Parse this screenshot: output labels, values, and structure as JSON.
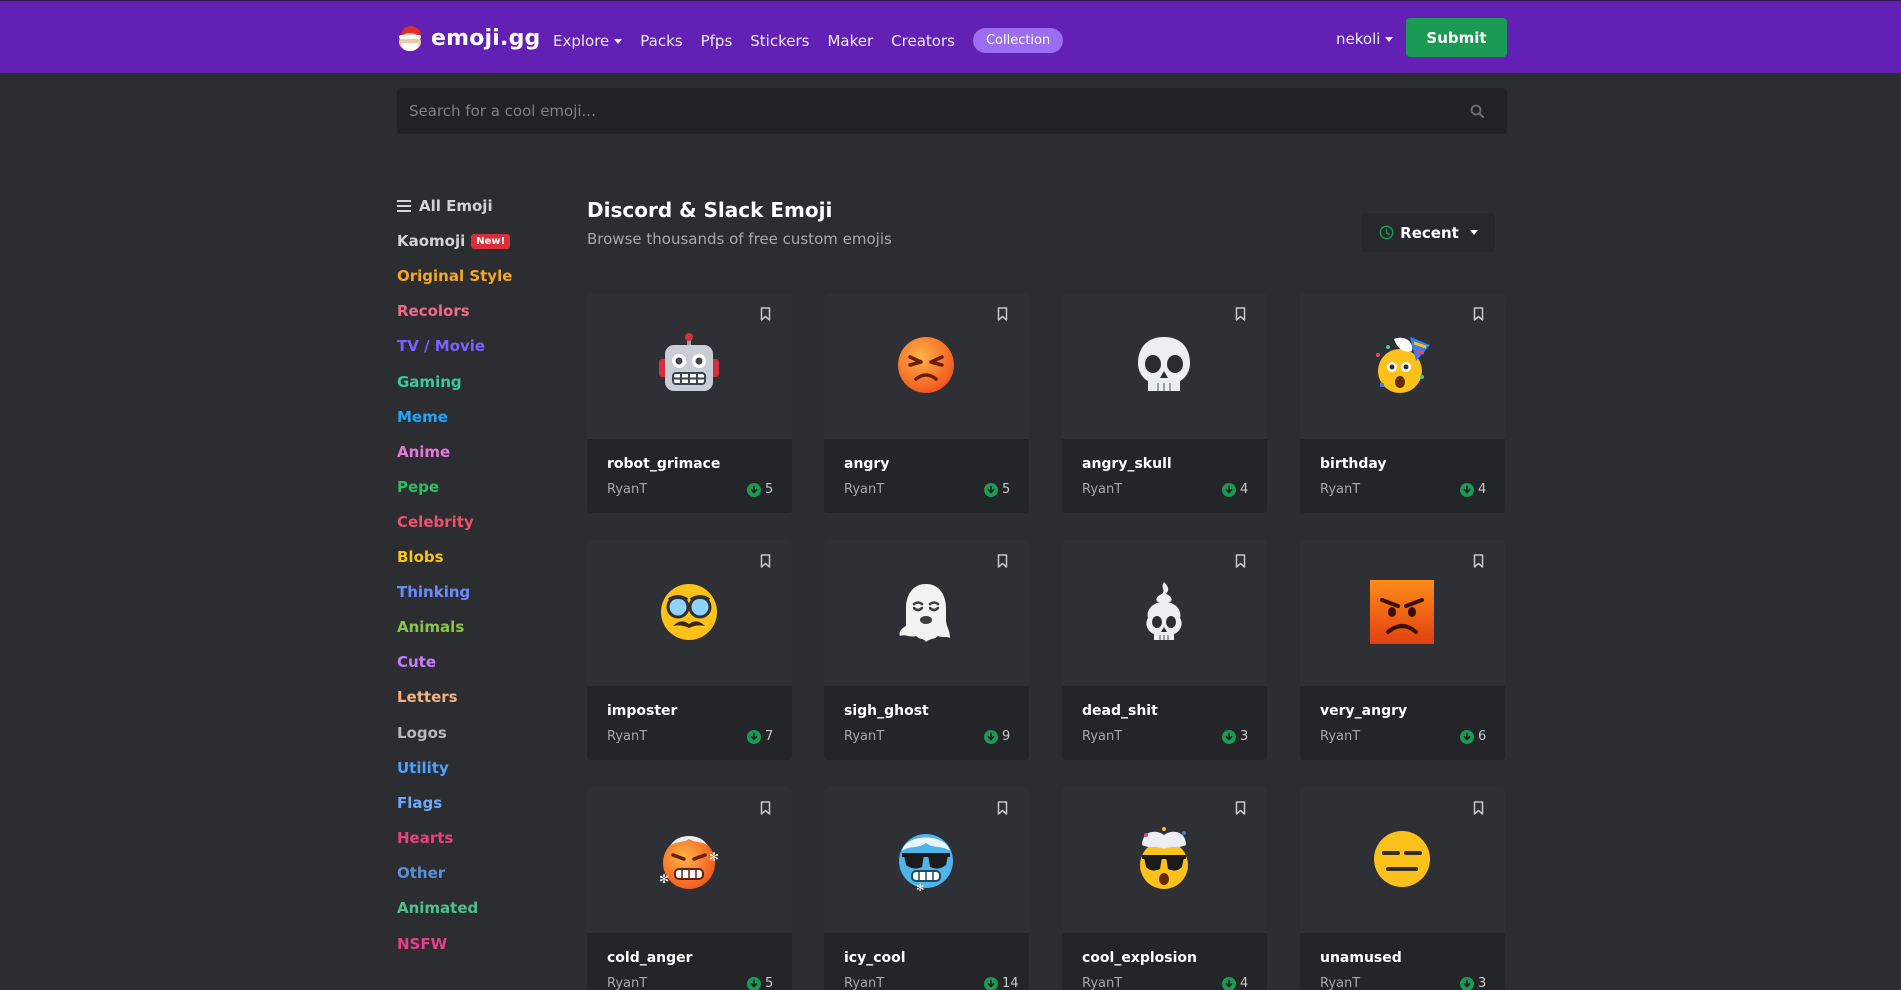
{
  "navbar": {
    "brand": "emoji.gg",
    "links": [
      {
        "label": "Explore",
        "dropdown": true
      },
      {
        "label": "Packs"
      },
      {
        "label": "Pfps"
      },
      {
        "label": "Stickers"
      },
      {
        "label": "Maker"
      },
      {
        "label": "Creators"
      }
    ],
    "collection_label": "Collection",
    "user": "nekoli",
    "submit_label": "Submit"
  },
  "search": {
    "placeholder": "Search for a cool emoji..."
  },
  "sidebar": {
    "all_label": "All Emoji",
    "new_badge": "New!",
    "items": [
      {
        "label": "Kaomoji",
        "color": "#d4d4d8",
        "badge": true
      },
      {
        "label": "Original Style",
        "color": "#f5a623"
      },
      {
        "label": "Recolors",
        "color": "#f06b8b"
      },
      {
        "label": "TV / Movie",
        "color": "#7b61ff"
      },
      {
        "label": "Gaming",
        "color": "#3ec8a0"
      },
      {
        "label": "Meme",
        "color": "#1ea7fd"
      },
      {
        "label": "Anime",
        "color": "#e37ad8"
      },
      {
        "label": "Pepe",
        "color": "#2dbe60"
      },
      {
        "label": "Celebrity",
        "color": "#f0506e"
      },
      {
        "label": "Blobs",
        "color": "#f5c518"
      },
      {
        "label": "Thinking",
        "color": "#6b8cff"
      },
      {
        "label": "Animals",
        "color": "#8bc34a"
      },
      {
        "label": "Cute",
        "color": "#c77dff"
      },
      {
        "label": "Letters",
        "color": "#f4b183"
      },
      {
        "label": "Logos",
        "color": "#b8b8bd"
      },
      {
        "label": "Utility",
        "color": "#4fa3ff"
      },
      {
        "label": "Flags",
        "color": "#6ea8ff"
      },
      {
        "label": "Hearts",
        "color": "#e8427c"
      },
      {
        "label": "Other",
        "color": "#5c8fd6"
      },
      {
        "label": "Animated",
        "color": "#4fc08d"
      },
      {
        "label": "NSFW",
        "color": "#e83e8c"
      }
    ]
  },
  "main": {
    "title": "Discord & Slack Emoji",
    "subtitle": "Browse thousands of free custom emojis",
    "sort_label": "Recent"
  },
  "emojis": [
    {
      "name": "robot_grimace",
      "author": "RyanT",
      "downloads": "5",
      "icon": "robot-icon"
    },
    {
      "name": "angry",
      "author": "RyanT",
      "downloads": "5",
      "icon": "angry-face-icon"
    },
    {
      "name": "angry_skull",
      "author": "RyanT",
      "downloads": "4",
      "icon": "skull-icon"
    },
    {
      "name": "birthday",
      "author": "RyanT",
      "downloads": "4",
      "icon": "party-face-icon"
    },
    {
      "name": "imposter",
      "author": "RyanT",
      "downloads": "7",
      "icon": "disguise-face-icon"
    },
    {
      "name": "sigh_ghost",
      "author": "RyanT",
      "downloads": "9",
      "icon": "ghost-icon"
    },
    {
      "name": "dead_shit",
      "author": "RyanT",
      "downloads": "3",
      "icon": "skull-swirl-icon"
    },
    {
      "name": "very_angry",
      "author": "RyanT",
      "downloads": "6",
      "icon": "angry-square-icon"
    },
    {
      "name": "cold_anger",
      "author": "RyanT",
      "downloads": "5",
      "icon": "cold-angry-face-icon"
    },
    {
      "name": "icy_cool",
      "author": "RyanT",
      "downloads": "14",
      "icon": "icy-sunglasses-face-icon"
    },
    {
      "name": "cool_explosion",
      "author": "RyanT",
      "downloads": "4",
      "icon": "exploding-sunglasses-face-icon"
    },
    {
      "name": "unamused",
      "author": "RyanT",
      "downloads": "3",
      "icon": "expressionless-face-icon"
    }
  ],
  "colors": {
    "navbar": "#6320b5",
    "background": "#2b2d31",
    "submit": "#1a9a52",
    "collection_pill": "#9b6df0",
    "download_icon": "#1a9a52"
  }
}
